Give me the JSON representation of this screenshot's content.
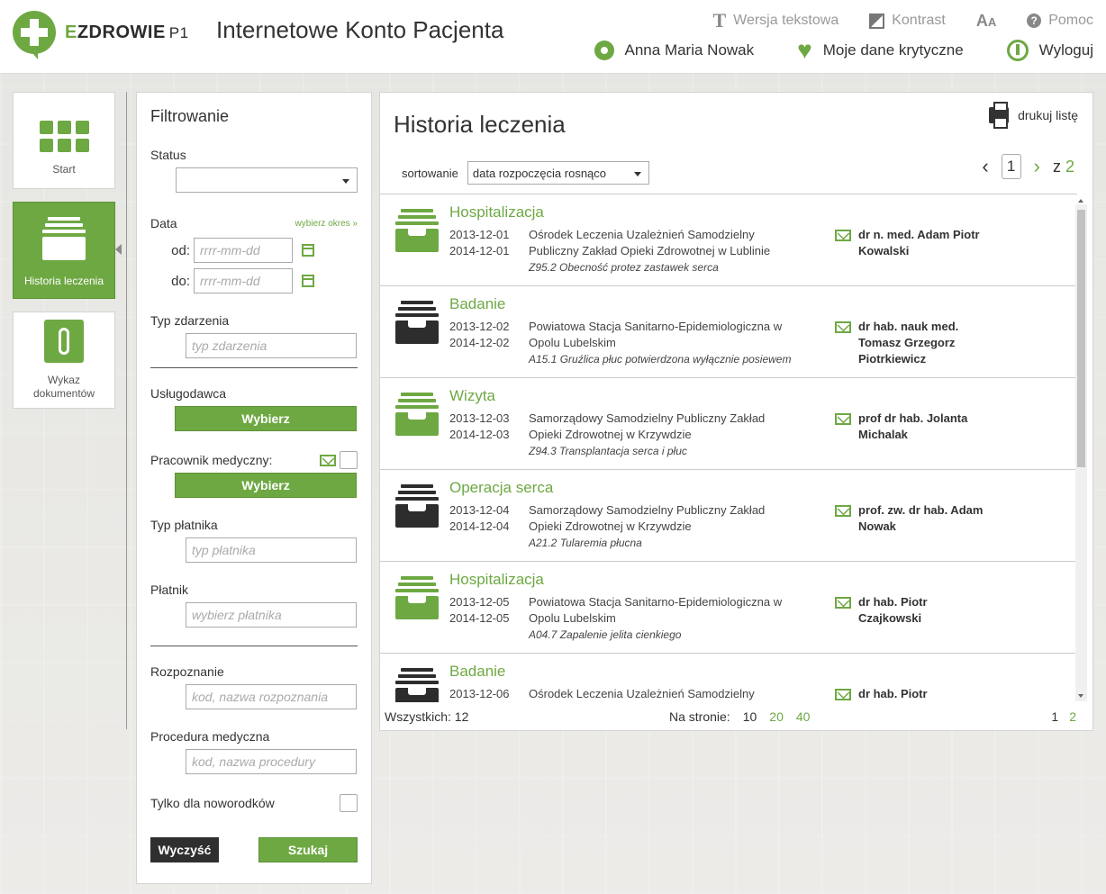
{
  "header": {
    "logo_text_e": "E",
    "logo_text_rest": "ZDROWIE",
    "logo_sub": "P1",
    "app_title": "Internetowe Konto Pacjenta",
    "top_links": [
      {
        "icon": "text-icon",
        "label": "Wersja tekstowa"
      },
      {
        "icon": "contrast-icon",
        "label": "Kontrast"
      },
      {
        "icon": "font-size-icon",
        "label": ""
      },
      {
        "icon": "help-icon",
        "label": "Pomoc"
      }
    ],
    "user_name": "Anna Maria Nowak",
    "critical_data": "Moje dane krytyczne",
    "logout": "Wyloguj"
  },
  "nav": {
    "start": "Start",
    "history": "Historia leczenia",
    "documents": "Wykaz dokumentów"
  },
  "filters": {
    "title": "Filtrowanie",
    "status_label": "Status",
    "status_value": "",
    "date_label": "Data",
    "date_range_link": "wybierz okres »",
    "from_label": "od:",
    "to_label": "do:",
    "date_placeholder": "rrrr-mm-dd",
    "event_type_label": "Typ zdarzenia",
    "event_type_placeholder": "typ zdarzenia",
    "provider_label": "Usługodawca",
    "choose": "Wybierz",
    "medical_worker_label": "Pracownik medyczny:",
    "payer_type_label": "Typ płatnika",
    "payer_type_placeholder": "typ płatnika",
    "payer_label": "Płatnik",
    "payer_placeholder": "wybierz płatnika",
    "diagnosis_label": "Rozpoznanie",
    "diagnosis_placeholder": "kod, nazwa rozpoznania",
    "procedure_label": "Procedura medyczna",
    "procedure_placeholder": "kod, nazwa procedury",
    "newborn_label": "Tylko dla noworodków",
    "clear": "Wyczyść",
    "search": "Szukaj"
  },
  "main": {
    "title": "Historia leczenia",
    "print": "drukuj listę",
    "sort_label": "sortowanie",
    "sort_value": "data rozpoczęcia rosnąco",
    "page_current": "1",
    "page_of": "z",
    "page_total": "2",
    "rows": [
      {
        "type": "Hospitalizacja",
        "icon": "green",
        "start": "2013-12-01",
        "end": "2014-12-01",
        "place": "Ośrodek Leczenia Uzależnień Samodzielny Publiczny Zakład Opieki Zdrowotnej w Lublinie",
        "diagnosis": "Z95.2 Obecność protez zastawek serca",
        "doctor": "dr n. med. Adam Piotr Kowalski"
      },
      {
        "type": "Badanie",
        "icon": "dark",
        "start": "2013-12-02",
        "end": "2014-12-02",
        "place": "Powiatowa Stacja Sanitarno-Epidemiologiczna w Opolu Lubelskim",
        "diagnosis": "A15.1 Gruźlica płuc potwierdzona wyłącznie posiewem",
        "doctor": "dr hab. nauk med. Tomasz Grzegorz Piotrkiewicz"
      },
      {
        "type": "Wizyta",
        "icon": "green",
        "start": "2013-12-03",
        "end": "2014-12-03",
        "place": "Samorządowy Samodzielny Publiczny Zakład Opieki Zdrowotnej w Krzywdzie",
        "diagnosis": "Z94.3 Transplantacja serca i płuc",
        "doctor": "prof dr hab. Jolanta Michalak"
      },
      {
        "type": "Operacja serca",
        "icon": "dark",
        "start": "2013-12-04",
        "end": "2014-12-04",
        "place": "Samorządowy Samodzielny Publiczny Zakład Opieki Zdrowotnej w Krzywdzie",
        "diagnosis": "A21.2 Tularemia płucna",
        "doctor": "prof. zw. dr hab. Adam Nowak"
      },
      {
        "type": "Hospitalizacja",
        "icon": "green",
        "start": "2013-12-05",
        "end": "2014-12-05",
        "place": "Powiatowa Stacja Sanitarno-Epidemiologiczna w Opolu Lubelskim",
        "diagnosis": "A04.7 Zapalenie jelita cienkiego",
        "doctor": "dr hab. Piotr Czajkowski"
      },
      {
        "type": "Badanie",
        "icon": "dark",
        "start": "2013-12-06",
        "end": "",
        "place": "Ośrodek Leczenia Uzależnień Samodzielny",
        "diagnosis": "",
        "doctor": "dr hab. Piotr"
      }
    ],
    "total_label": "Wszystkich: 12",
    "per_page_label": "Na stronie:",
    "per_page_options": [
      "10",
      "20",
      "40"
    ],
    "pages": [
      "1",
      "2"
    ]
  },
  "colors": {
    "accent": "#6ea843",
    "dark": "#2d2d2d"
  }
}
